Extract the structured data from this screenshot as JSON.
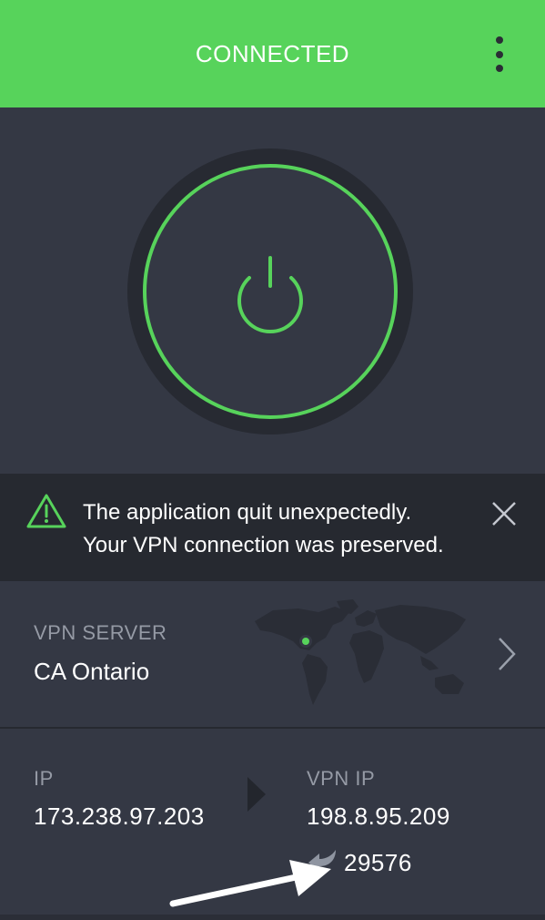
{
  "header": {
    "status": "CONNECTED",
    "menu_icon": "kebab-menu-icon",
    "background_color": "#57d35b"
  },
  "power": {
    "icon": "power-icon",
    "ring_color": "#57d35b",
    "connected": true
  },
  "notice": {
    "icon": "warning-triangle-icon",
    "line1": "The application quit unexpectedly.",
    "line2": "Your VPN connection was preserved.",
    "close_icon": "close-icon"
  },
  "server": {
    "label": "VPN SERVER",
    "value": "CA Ontario",
    "map_icon": "world-map-icon",
    "chevron_icon": "chevron-right-icon"
  },
  "connection": {
    "ip_label": "IP",
    "ip_value": "173.238.97.203",
    "vpn_ip_label": "VPN IP",
    "vpn_ip_value": "198.8.95.209",
    "port_icon": "port-forward-icon",
    "port_value": "29576"
  },
  "colors": {
    "accent": "#57d35b",
    "background": "#343844",
    "panel_dark": "#262930",
    "muted_text": "#959aa5"
  }
}
